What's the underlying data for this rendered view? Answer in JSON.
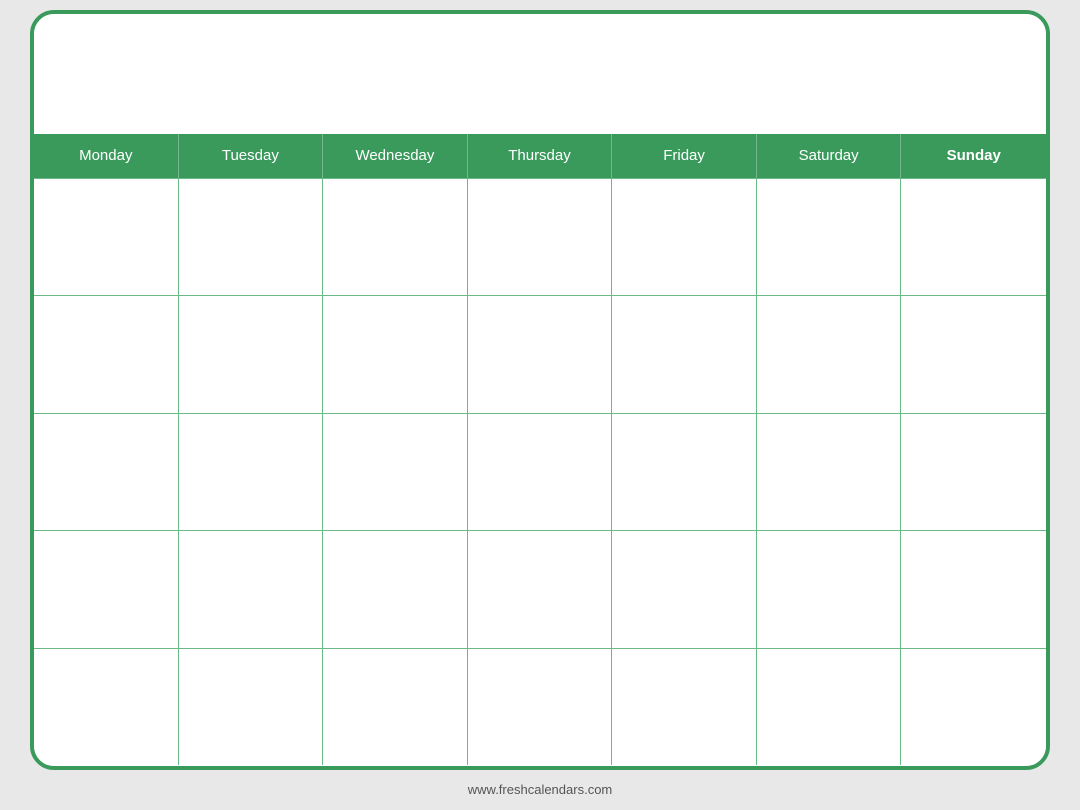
{
  "calendar": {
    "title": "",
    "days": [
      {
        "label": "Monday",
        "bold": false
      },
      {
        "label": "Tuesday",
        "bold": false
      },
      {
        "label": "Wednesday",
        "bold": false
      },
      {
        "label": "Thursday",
        "bold": false
      },
      {
        "label": "Friday",
        "bold": false
      },
      {
        "label": "Saturday",
        "bold": false
      },
      {
        "label": "Sunday",
        "bold": true
      }
    ],
    "rows": 5
  },
  "footer": {
    "url": "www.freshcalendars.com"
  }
}
